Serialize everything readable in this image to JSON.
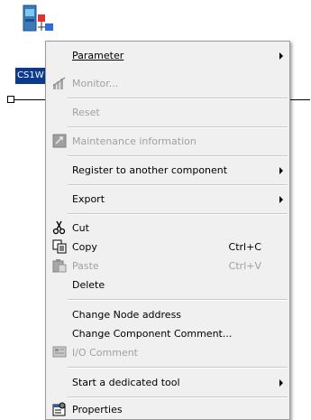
{
  "node": {
    "label": "CS1W"
  },
  "menu": {
    "parameter": "Parameter",
    "monitor": "Monitor...",
    "reset": "Reset",
    "maintenance": "Maintenance information",
    "register": "Register to another component",
    "export": "Export",
    "cut": "Cut",
    "copy": "Copy",
    "copy_shortcut": "Ctrl+C",
    "paste": "Paste",
    "paste_shortcut": "Ctrl+V",
    "delete": "Delete",
    "change_node_address": "Change Node address",
    "change_component_comment": "Change Component Comment...",
    "io_comment": "I/O Comment",
    "start_tool": "Start a dedicated tool",
    "properties": "Properties"
  }
}
